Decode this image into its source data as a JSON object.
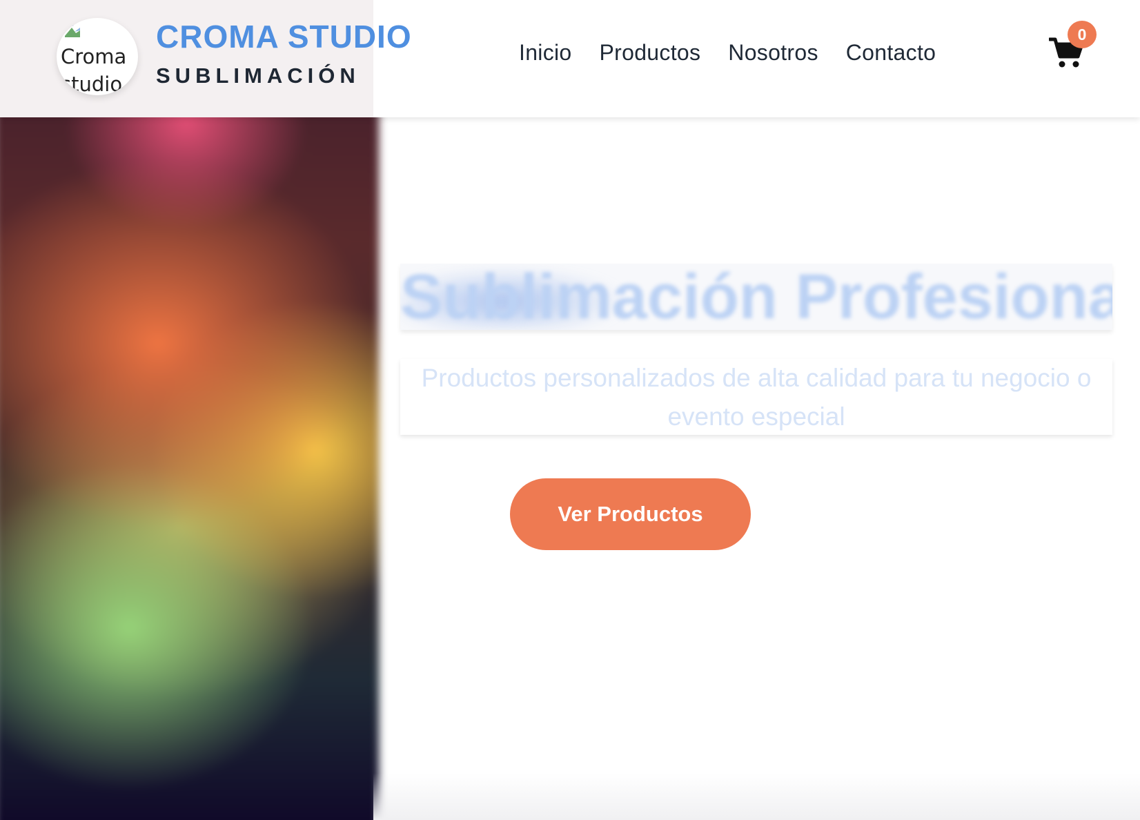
{
  "header": {
    "logo_alt": "Croma studio",
    "brand_title": "CROMA STUDIO",
    "brand_subtitle": "SUBLIMACIÓN",
    "nav": [
      "Inicio",
      "Productos",
      "Nosotros",
      "Contacto"
    ],
    "cart_icon": "shopping-cart-icon",
    "cart_count": "0"
  },
  "hero": {
    "title": "Sublimación Profesional",
    "subtitle": "Productos personalizados de alta calidad para tu negocio o evento especial",
    "cta_label": "Ver Productos"
  },
  "colors": {
    "brand_blue": "#4f8fe0",
    "accent_orange": "#ee7a52",
    "nav_text": "#1f2936"
  }
}
